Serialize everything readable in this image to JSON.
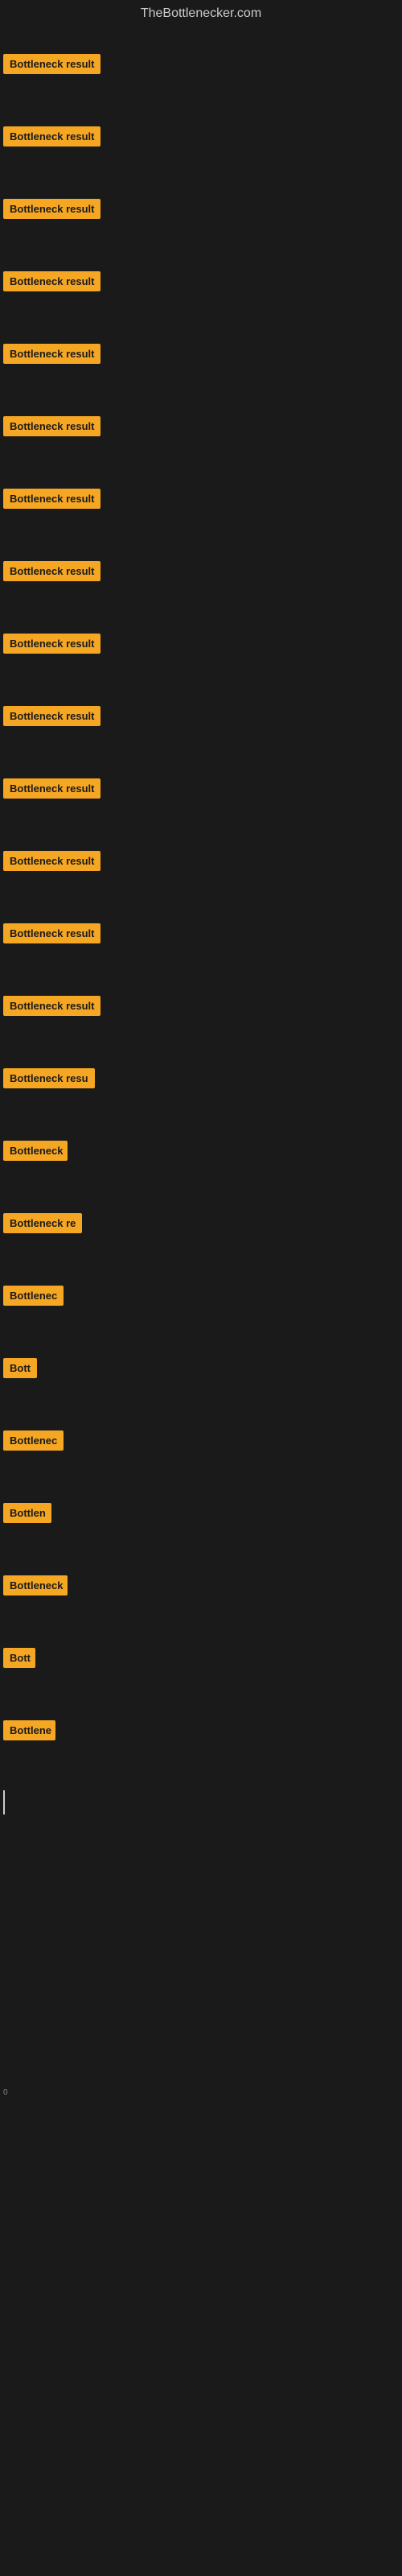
{
  "site": {
    "title": "TheBottlenecker.com"
  },
  "rows": [
    {
      "label": "Bottleneck result",
      "width": 140,
      "visible": true
    },
    {
      "label": "Bottleneck result",
      "width": 140,
      "visible": true
    },
    {
      "label": "Bottleneck result",
      "width": 140,
      "visible": true
    },
    {
      "label": "Bottleneck result",
      "width": 140,
      "visible": true
    },
    {
      "label": "Bottleneck result",
      "width": 140,
      "visible": true
    },
    {
      "label": "Bottleneck result",
      "width": 140,
      "visible": true
    },
    {
      "label": "Bottleneck result",
      "width": 140,
      "visible": true
    },
    {
      "label": "Bottleneck result",
      "width": 140,
      "visible": true
    },
    {
      "label": "Bottleneck result",
      "width": 140,
      "visible": true
    },
    {
      "label": "Bottleneck result",
      "width": 140,
      "visible": true
    },
    {
      "label": "Bottleneck result",
      "width": 140,
      "visible": true
    },
    {
      "label": "Bottleneck result",
      "width": 140,
      "visible": true
    },
    {
      "label": "Bottleneck result",
      "width": 140,
      "visible": true
    },
    {
      "label": "Bottleneck result",
      "width": 140,
      "visible": true
    },
    {
      "label": "Bottleneck resu",
      "width": 120,
      "visible": true
    },
    {
      "label": "Bottleneck",
      "width": 80,
      "visible": true
    },
    {
      "label": "Bottleneck re",
      "width": 100,
      "visible": true
    },
    {
      "label": "Bottlenec",
      "width": 75,
      "visible": true
    },
    {
      "label": "Bott",
      "width": 45,
      "visible": true
    },
    {
      "label": "Bottlenec",
      "width": 75,
      "visible": true
    },
    {
      "label": "Bottlen",
      "width": 60,
      "visible": true
    },
    {
      "label": "Bottleneck",
      "width": 80,
      "visible": true
    },
    {
      "label": "Bott",
      "width": 40,
      "visible": true
    },
    {
      "label": "Bottlene",
      "width": 65,
      "visible": true
    },
    {
      "label": "",
      "width": 0,
      "visible": false,
      "cursor": true
    },
    {
      "label": "",
      "width": 0,
      "visible": false
    },
    {
      "label": "",
      "width": 0,
      "visible": false
    },
    {
      "label": "",
      "width": 0,
      "visible": false
    },
    {
      "label": "0",
      "width": 10,
      "visible": true,
      "small": true
    },
    {
      "label": "",
      "width": 0,
      "visible": false
    },
    {
      "label": "",
      "width": 0,
      "visible": false
    },
    {
      "label": "",
      "width": 0,
      "visible": false
    },
    {
      "label": "",
      "width": 0,
      "visible": false
    },
    {
      "label": "",
      "width": 0,
      "visible": false
    }
  ]
}
